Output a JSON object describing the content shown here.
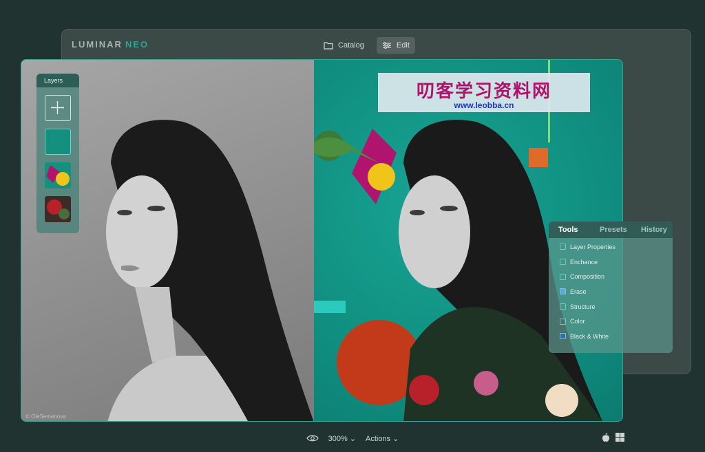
{
  "brand": {
    "name": "LUMINAR",
    "suffix": "NEO"
  },
  "topnav": {
    "catalog_label": "Catalog",
    "edit_label": "Edit"
  },
  "layers": {
    "title": "Layers"
  },
  "photo": {
    "credit": "© OleSemenova"
  },
  "tools_panel": {
    "tabs": [
      "Tools",
      "Presets",
      "History"
    ],
    "items": [
      "Layer Properties",
      "Enchance",
      "Composition",
      "Erase",
      "Structure",
      "Color",
      "Black & White"
    ]
  },
  "bottombar": {
    "zoom": "300%",
    "actions_label": "Actions"
  },
  "watermark": {
    "title": "叨客学习资料网",
    "url": "www.leobba.cn"
  },
  "colors": {
    "accent": "#2aa597",
    "bg": "#213330",
    "teal_photo": "#0e8a7c"
  }
}
